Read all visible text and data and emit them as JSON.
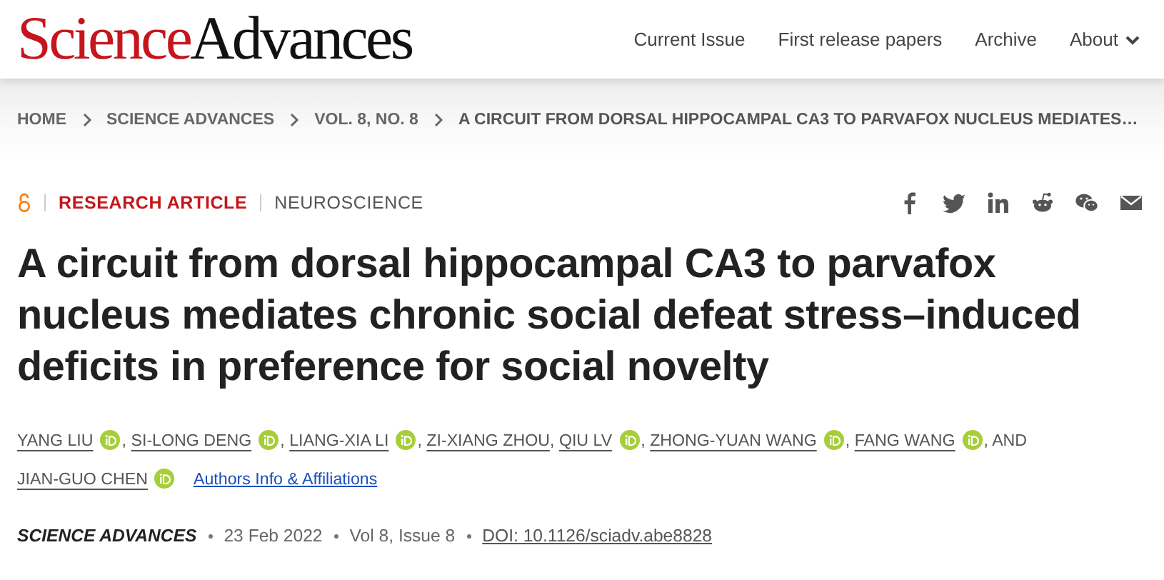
{
  "header": {
    "logo": {
      "part_1": "Science",
      "part_2": "Advances"
    },
    "nav": [
      {
        "label": "Current Issue",
        "dropdown": false
      },
      {
        "label": "First release papers",
        "dropdown": false
      },
      {
        "label": "Archive",
        "dropdown": false
      },
      {
        "label": "About",
        "dropdown": true
      }
    ]
  },
  "breadcrumb": [
    "HOME",
    "SCIENCE ADVANCES",
    "VOL. 8, NO. 8",
    "A CIRCUIT FROM DORSAL HIPPOCAMPAL CA3 TO PARVAFOX NUCLEUS MEDIATES…"
  ],
  "article": {
    "open_access": true,
    "type": "RESEARCH ARTICLE",
    "subject": "NEUROSCIENCE",
    "share": [
      {
        "kind": "facebook"
      },
      {
        "kind": "twitter"
      },
      {
        "kind": "linkedin"
      },
      {
        "kind": "reddit"
      },
      {
        "kind": "wechat"
      },
      {
        "kind": "email"
      }
    ],
    "title": "A circuit from dorsal hippocampal CA3 to parvafox nucleus mediates chronic social defeat stress–induced deficits in preference for social novelty",
    "authors": [
      {
        "name": "YANG LIU",
        "orcid": true
      },
      {
        "prefix": ",",
        "name": "SI-LONG DENG",
        "orcid": true
      },
      {
        "prefix": ",",
        "name": "LIANG-XIA LI",
        "orcid": true
      },
      {
        "prefix": ",",
        "name": "ZI-XIANG ZHOU",
        "orcid": false
      },
      {
        "prefix": ",",
        "name": "QIU LV",
        "orcid": true
      },
      {
        "prefix": ",",
        "name": "ZHONG-YUAN WANG",
        "orcid": true
      },
      {
        "prefix": ",",
        "name": "FANG WANG",
        "orcid": true
      },
      {
        "prefix": ", AND",
        "name": "JIAN-GUO CHEN",
        "orcid": true
      }
    ],
    "affiliations_link": "Authors Info & Affiliations",
    "journal": "SCIENCE ADVANCES",
    "date": "23 Feb 2022",
    "issue": "Vol 8, Issue 8",
    "doi": "DOI: 10.1126/sciadv.abe8828"
  }
}
